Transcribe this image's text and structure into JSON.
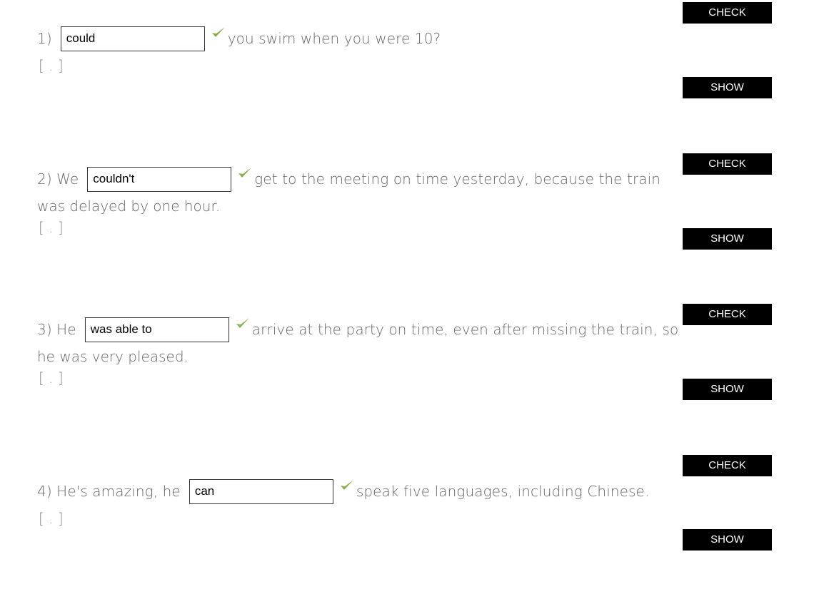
{
  "buttons": {
    "check_label": "CHECK",
    "show_label": "SHOW"
  },
  "hint_text": "[ . ]",
  "colors": {
    "tick": "#8cae4a",
    "button_bg": "#000000",
    "text": "#666666"
  },
  "questions": [
    {
      "before": "1)",
      "answer": "could",
      "after": "you swim when you were 10?",
      "continuation": ""
    },
    {
      "before": "2) We",
      "answer": "couldn't",
      "after": "get to the meeting on time yesterday, because the train",
      "continuation": "was delayed by one hour."
    },
    {
      "before": "3) He",
      "answer": "was able to",
      "after": "arrive at the party on time, even after missing the train, so",
      "continuation": "he was very pleased."
    },
    {
      "before": "4) He's amazing, he",
      "answer": "can",
      "after": "speak five languages, including Chinese.",
      "continuation": ""
    }
  ]
}
